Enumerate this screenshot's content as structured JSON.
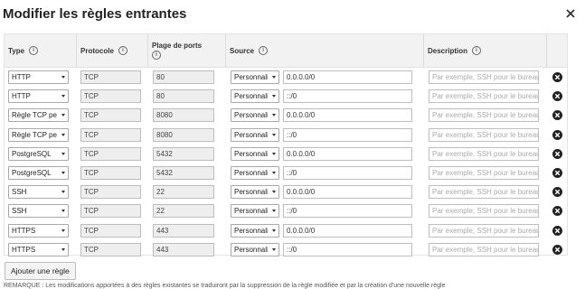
{
  "dialog": {
    "title": "Modifier les règles entrantes",
    "close_icon": "close-icon"
  },
  "columns": {
    "type": "Type",
    "protocol": "Protocole",
    "port_range": "Plage de ports",
    "source": "Source",
    "description": "Description"
  },
  "description_placeholder": "Par exemple, SSH pour le bureau",
  "rules": [
    {
      "type": "HTTP",
      "protocol": "TCP",
      "port": "80",
      "source_type": "Personnalisé",
      "source": "0.0.0.0/0"
    },
    {
      "type": "HTTP",
      "protocol": "TCP",
      "port": "80",
      "source_type": "Personnalisé",
      "source": "::/0"
    },
    {
      "type": "Règle TCP personnalisée",
      "protocol": "TCP",
      "port": "8080",
      "source_type": "Personnalisé",
      "source": "0.0.0.0/0"
    },
    {
      "type": "Règle TCP personnalisée",
      "protocol": "TCP",
      "port": "8080",
      "source_type": "Personnalisé",
      "source": "::/0"
    },
    {
      "type": "PostgreSQL",
      "protocol": "TCP",
      "port": "5432",
      "source_type": "Personnalisé",
      "source": "0.0.0.0/0"
    },
    {
      "type": "PostgreSQL",
      "protocol": "TCP",
      "port": "5432",
      "source_type": "Personnalisé",
      "source": "::/0"
    },
    {
      "type": "SSH",
      "protocol": "TCP",
      "port": "22",
      "source_type": "Personnalisé",
      "source": "0.0.0.0/0"
    },
    {
      "type": "SSH",
      "protocol": "TCP",
      "port": "22",
      "source_type": "Personnalisé",
      "source": "::/0"
    },
    {
      "type": "HTTPS",
      "protocol": "TCP",
      "port": "443",
      "source_type": "Personnalisé",
      "source": "0.0.0.0/0"
    },
    {
      "type": "HTTPS",
      "protocol": "TCP",
      "port": "443",
      "source_type": "Personnalisé",
      "source": "::/0"
    }
  ],
  "add_rule_label": "Ajouter une règle",
  "note": "REMARQUE : Les modifications apportées à des règles existantes se traduiront par la suppression de la règle modifiée et par la création d'une nouvelle règle"
}
